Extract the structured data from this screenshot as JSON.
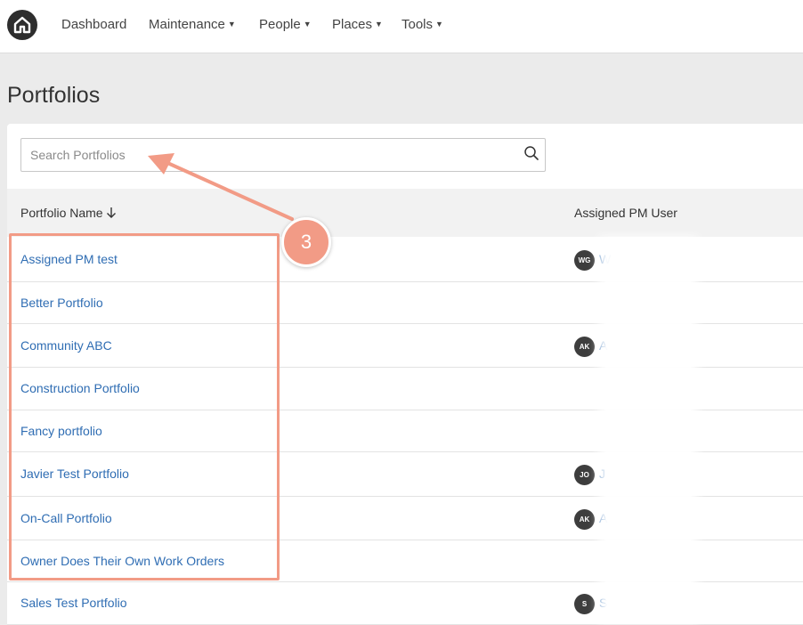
{
  "navbar": {
    "logo_icon": "home-icon",
    "items": [
      {
        "label": "Dashboard",
        "has_dropdown": false
      },
      {
        "label": "Maintenance",
        "has_dropdown": true
      },
      {
        "label": "People",
        "has_dropdown": true
      },
      {
        "label": "Places",
        "has_dropdown": true
      },
      {
        "label": "Tools",
        "has_dropdown": true
      }
    ]
  },
  "page": {
    "title": "Portfolios"
  },
  "search": {
    "placeholder": "Search Portfolios",
    "value": "",
    "icon": "search-icon"
  },
  "table": {
    "columns": [
      {
        "label": "Portfolio Name",
        "sort_icon": "arrow-down-icon"
      },
      {
        "label": "Assigned PM User"
      }
    ],
    "rows": [
      {
        "name": "Assigned PM test",
        "pm_initials": "WG",
        "pm_name_visible": "W"
      },
      {
        "name": "Better Portfolio",
        "pm_initials": "",
        "pm_name_visible": ""
      },
      {
        "name": "Community ABC",
        "pm_initials": "AK",
        "pm_name_visible": "A"
      },
      {
        "name": "Construction Portfolio",
        "pm_initials": "",
        "pm_name_visible": ""
      },
      {
        "name": "Fancy portfolio",
        "pm_initials": "",
        "pm_name_visible": ""
      },
      {
        "name": "Javier Test Portfolio",
        "pm_initials": "JO",
        "pm_name_visible": "J"
      },
      {
        "name": "On-Call Portfolio",
        "pm_initials": "AK",
        "pm_name_visible": "A"
      },
      {
        "name": "Owner Does Their Own Work Orders",
        "pm_initials": "",
        "pm_name_visible": ""
      },
      {
        "name": "Sales Test Portfolio",
        "pm_initials": "S",
        "pm_name_visible": "S"
      }
    ]
  },
  "annotation": {
    "step_number": "3",
    "color": "#f29b86"
  },
  "colors": {
    "link": "#2f6db3",
    "avatar_bg": "#3d3d3d",
    "header_bg": "#f2f2f2",
    "page_bg": "#ebebeb"
  }
}
